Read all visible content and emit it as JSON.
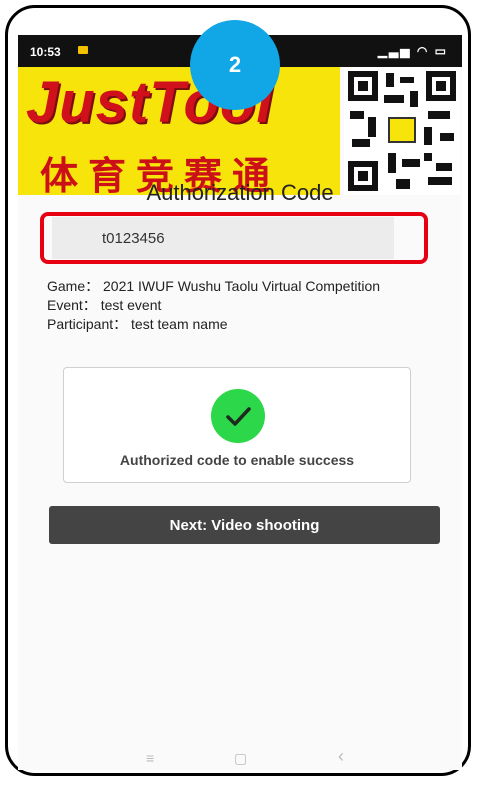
{
  "status_bar": {
    "time": "10:53",
    "system_icons": "▁▃▅ ◠ ▭"
  },
  "banner": {
    "brand": "JustTool",
    "chinese": "体育竞赛通"
  },
  "step_badge": "2",
  "page_title": "Authorization Code",
  "code_field": {
    "value": "t0123456"
  },
  "info": {
    "game": "Game： 2021 IWUF Wushu Taolu Virtual Competition",
    "event": "Event： test event",
    "participant": "Participant： test team name"
  },
  "result": {
    "message": "Authorized code to enable success",
    "icon": "check-icon",
    "color": "#2cd74a"
  },
  "next_button": {
    "label": "Next: Video shooting"
  },
  "nav_bar": {
    "menu": "≡",
    "home": "▢",
    "back": "‹"
  },
  "colors": {
    "highlight": "#e60012",
    "badge": "#11a7e6",
    "banner_yellow": "#f7e40a",
    "brand_red": "#d0101a"
  }
}
